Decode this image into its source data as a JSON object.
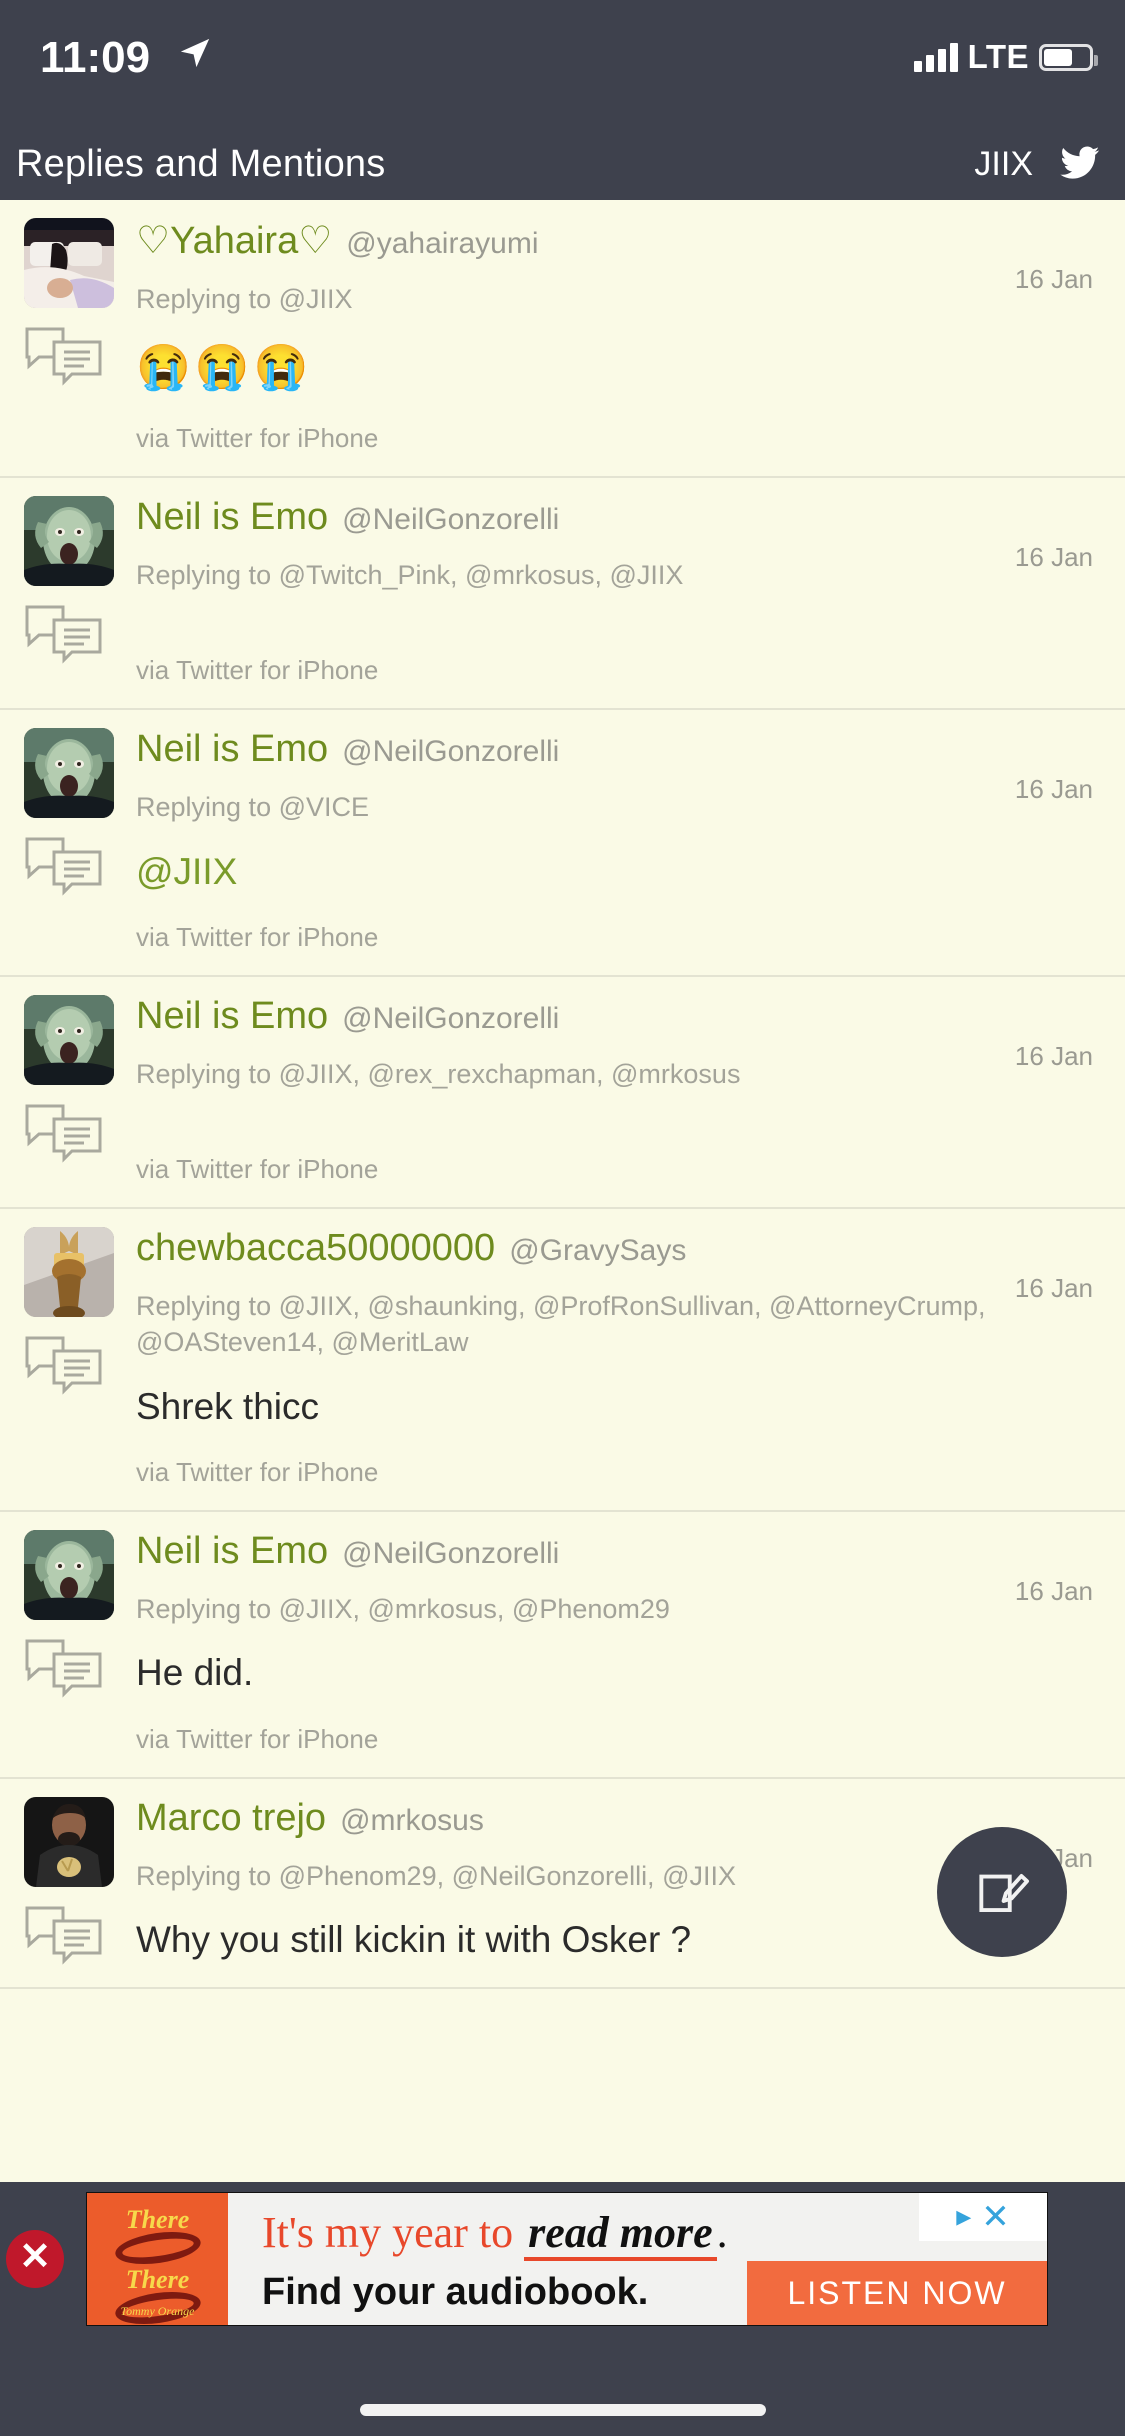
{
  "status_bar": {
    "time": "11:09",
    "location_icon": "location-arrow-icon",
    "signal_icon": "signal-bars-icon",
    "carrier": "LTE",
    "battery_icon": "battery-icon",
    "battery_level": 58
  },
  "header": {
    "title": "Replies and Mentions",
    "account_handle": "JIIX",
    "logo_icon": "twitter-bird-icon"
  },
  "colors": {
    "chrome": "#3E414D",
    "feed_background": "#FAFAE6",
    "display_name": "#6E8B1E",
    "muted_text": "#9A9A91",
    "mention_link": "#7A9B2A",
    "ad_accent": "#EC5C2B",
    "close_button": "#C0182B"
  },
  "tweets": [
    {
      "display_name": "♡Yahaira♡",
      "handle": "@yahairayumi",
      "date": "16 Jan",
      "replying_to": "Replying to @JIIX",
      "content": "😭😭😭",
      "content_type": "emoji",
      "via": "via Twitter for iPhone",
      "avatar": "photo-bedroom"
    },
    {
      "display_name": "Neil is Emo",
      "handle": "@NeilGonzorelli",
      "date": "16 Jan",
      "replying_to": "Replying to @Twitch_Pink, @mrkosus, @JIIX",
      "content": "",
      "content_type": "none",
      "via": "via Twitter for iPhone",
      "avatar": "photo-zombie"
    },
    {
      "display_name": "Neil is Emo",
      "handle": "@NeilGonzorelli",
      "date": "16 Jan",
      "replying_to": "Replying to @VICE",
      "content": "@JIIX",
      "content_type": "mention",
      "via": "via Twitter for iPhone",
      "avatar": "photo-zombie"
    },
    {
      "display_name": "Neil is Emo",
      "handle": "@NeilGonzorelli",
      "date": "16 Jan",
      "replying_to": "Replying to @JIIX, @rex_rexchapman, @mrkosus",
      "content": "",
      "content_type": "none",
      "via": "via Twitter for iPhone",
      "avatar": "photo-zombie"
    },
    {
      "display_name": "chewbacca50000000",
      "handle": "@GravySays",
      "date": "16 Jan",
      "replying_to": "Replying to @JIIX, @shaunking, @ProfRonSullivan, @AttorneyCrump, @OASteven14, @MeritLaw",
      "content": "Shrek thicc",
      "content_type": "text",
      "via": "via Twitter for iPhone",
      "avatar": "photo-statue"
    },
    {
      "display_name": "Neil is Emo",
      "handle": "@NeilGonzorelli",
      "date": "16 Jan",
      "replying_to": "Replying to @JIIX, @mrkosus, @Phenom29",
      "content": "He did.",
      "content_type": "text",
      "via": "via Twitter for iPhone",
      "avatar": "photo-zombie"
    },
    {
      "display_name": "Marco trejo",
      "handle": "@mrkosus",
      "date": "16 Jan",
      "replying_to": "Replying to @Phenom29, @NeilGonzorelli, @JIIX",
      "content": "Why you still kickin it with Osker ?",
      "content_type": "text",
      "via": "",
      "avatar": "photo-man"
    }
  ],
  "compose_button": {
    "icon": "compose-pencil-icon",
    "label": "Compose"
  },
  "ad": {
    "close_icon": "close-circle-icon",
    "cover_line1": "There",
    "cover_line2": "There",
    "cover_author": "Tommy Orange",
    "headline_prefix": "It's my year to ",
    "headline_script": "read more",
    "headline_suffix": ".",
    "subline": "Find your audiobook.",
    "cta": "LISTEN NOW",
    "adchoices_icon": "adchoices-icon",
    "dismiss_icon": "ad-dismiss-x-icon"
  },
  "home_indicator": "home-indicator"
}
